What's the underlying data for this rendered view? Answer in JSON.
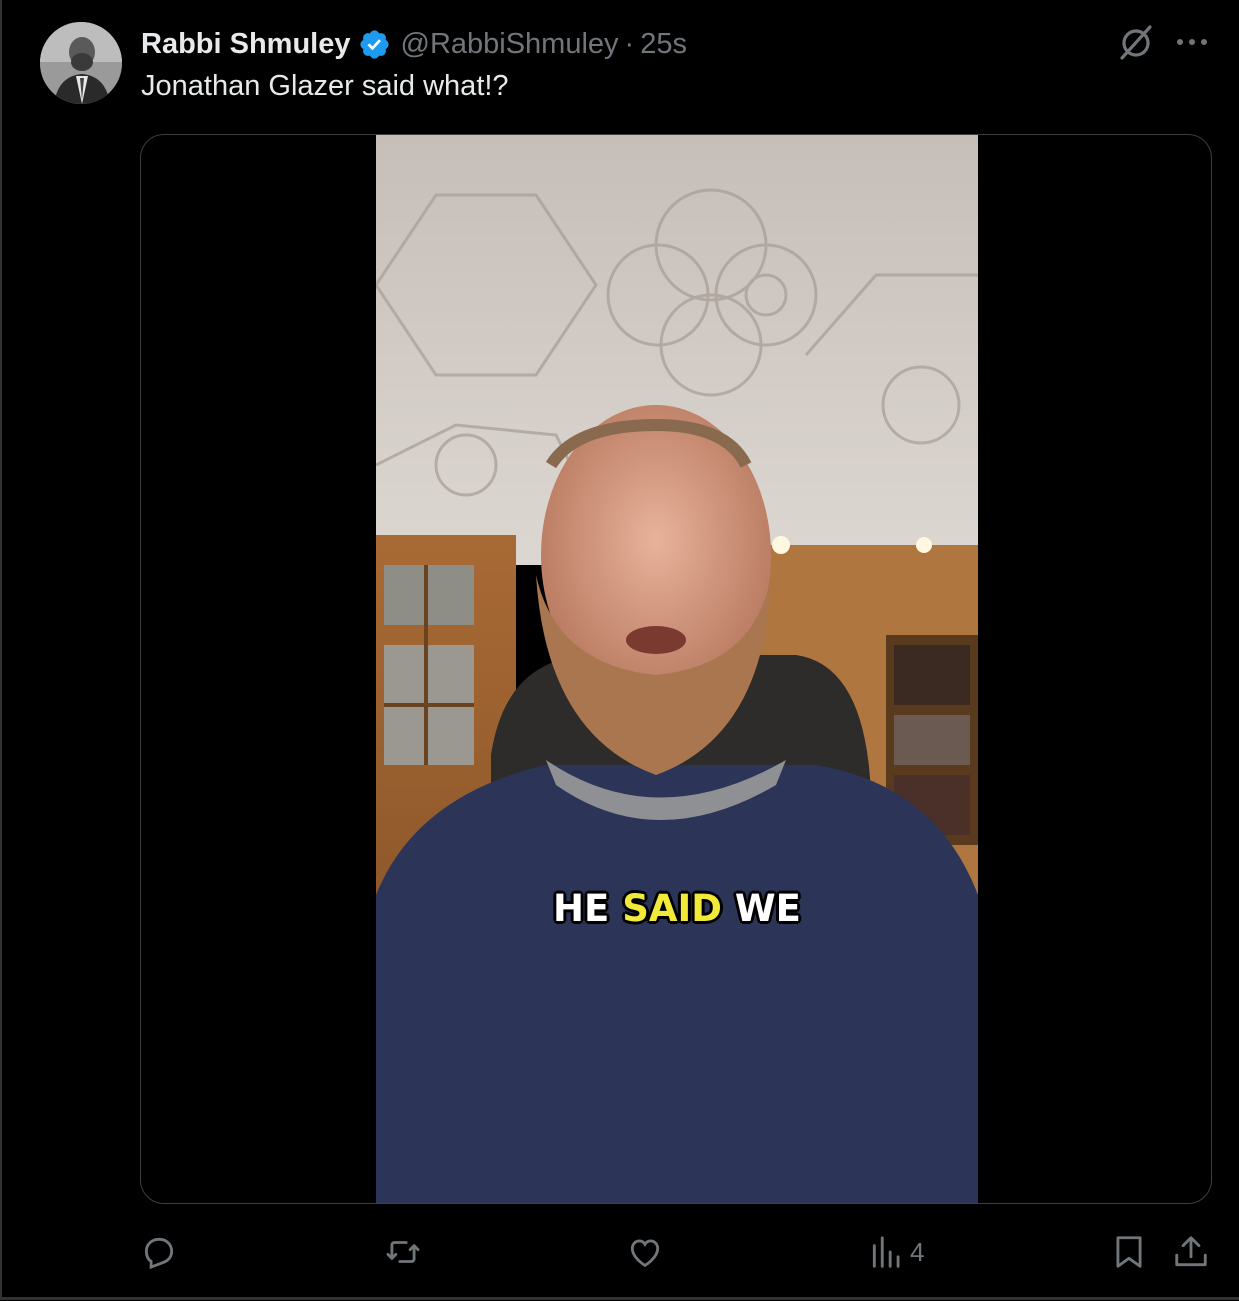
{
  "tweet": {
    "display_name": "Rabbi Shmuley",
    "handle": "@RabbiShmuley",
    "separator": "·",
    "time": "25s",
    "text": "Jonathan Glazer said what!?",
    "verified": true
  },
  "video": {
    "caption_parts": [
      "HE",
      "SAID",
      "WE"
    ]
  },
  "actions": {
    "views_count": "4"
  },
  "icons": {
    "reply": "reply-icon",
    "retweet": "retweet-icon",
    "like": "heart-icon",
    "views": "views-icon",
    "bookmark": "bookmark-icon",
    "share": "share-icon",
    "grok": "grok-icon",
    "more": "more-icon"
  },
  "colors": {
    "background": "#000000",
    "text_primary": "#e7e9ea",
    "text_secondary": "#71767b",
    "verified_badge": "#1d9bf0",
    "caption_highlight": "#f2ea3a"
  }
}
